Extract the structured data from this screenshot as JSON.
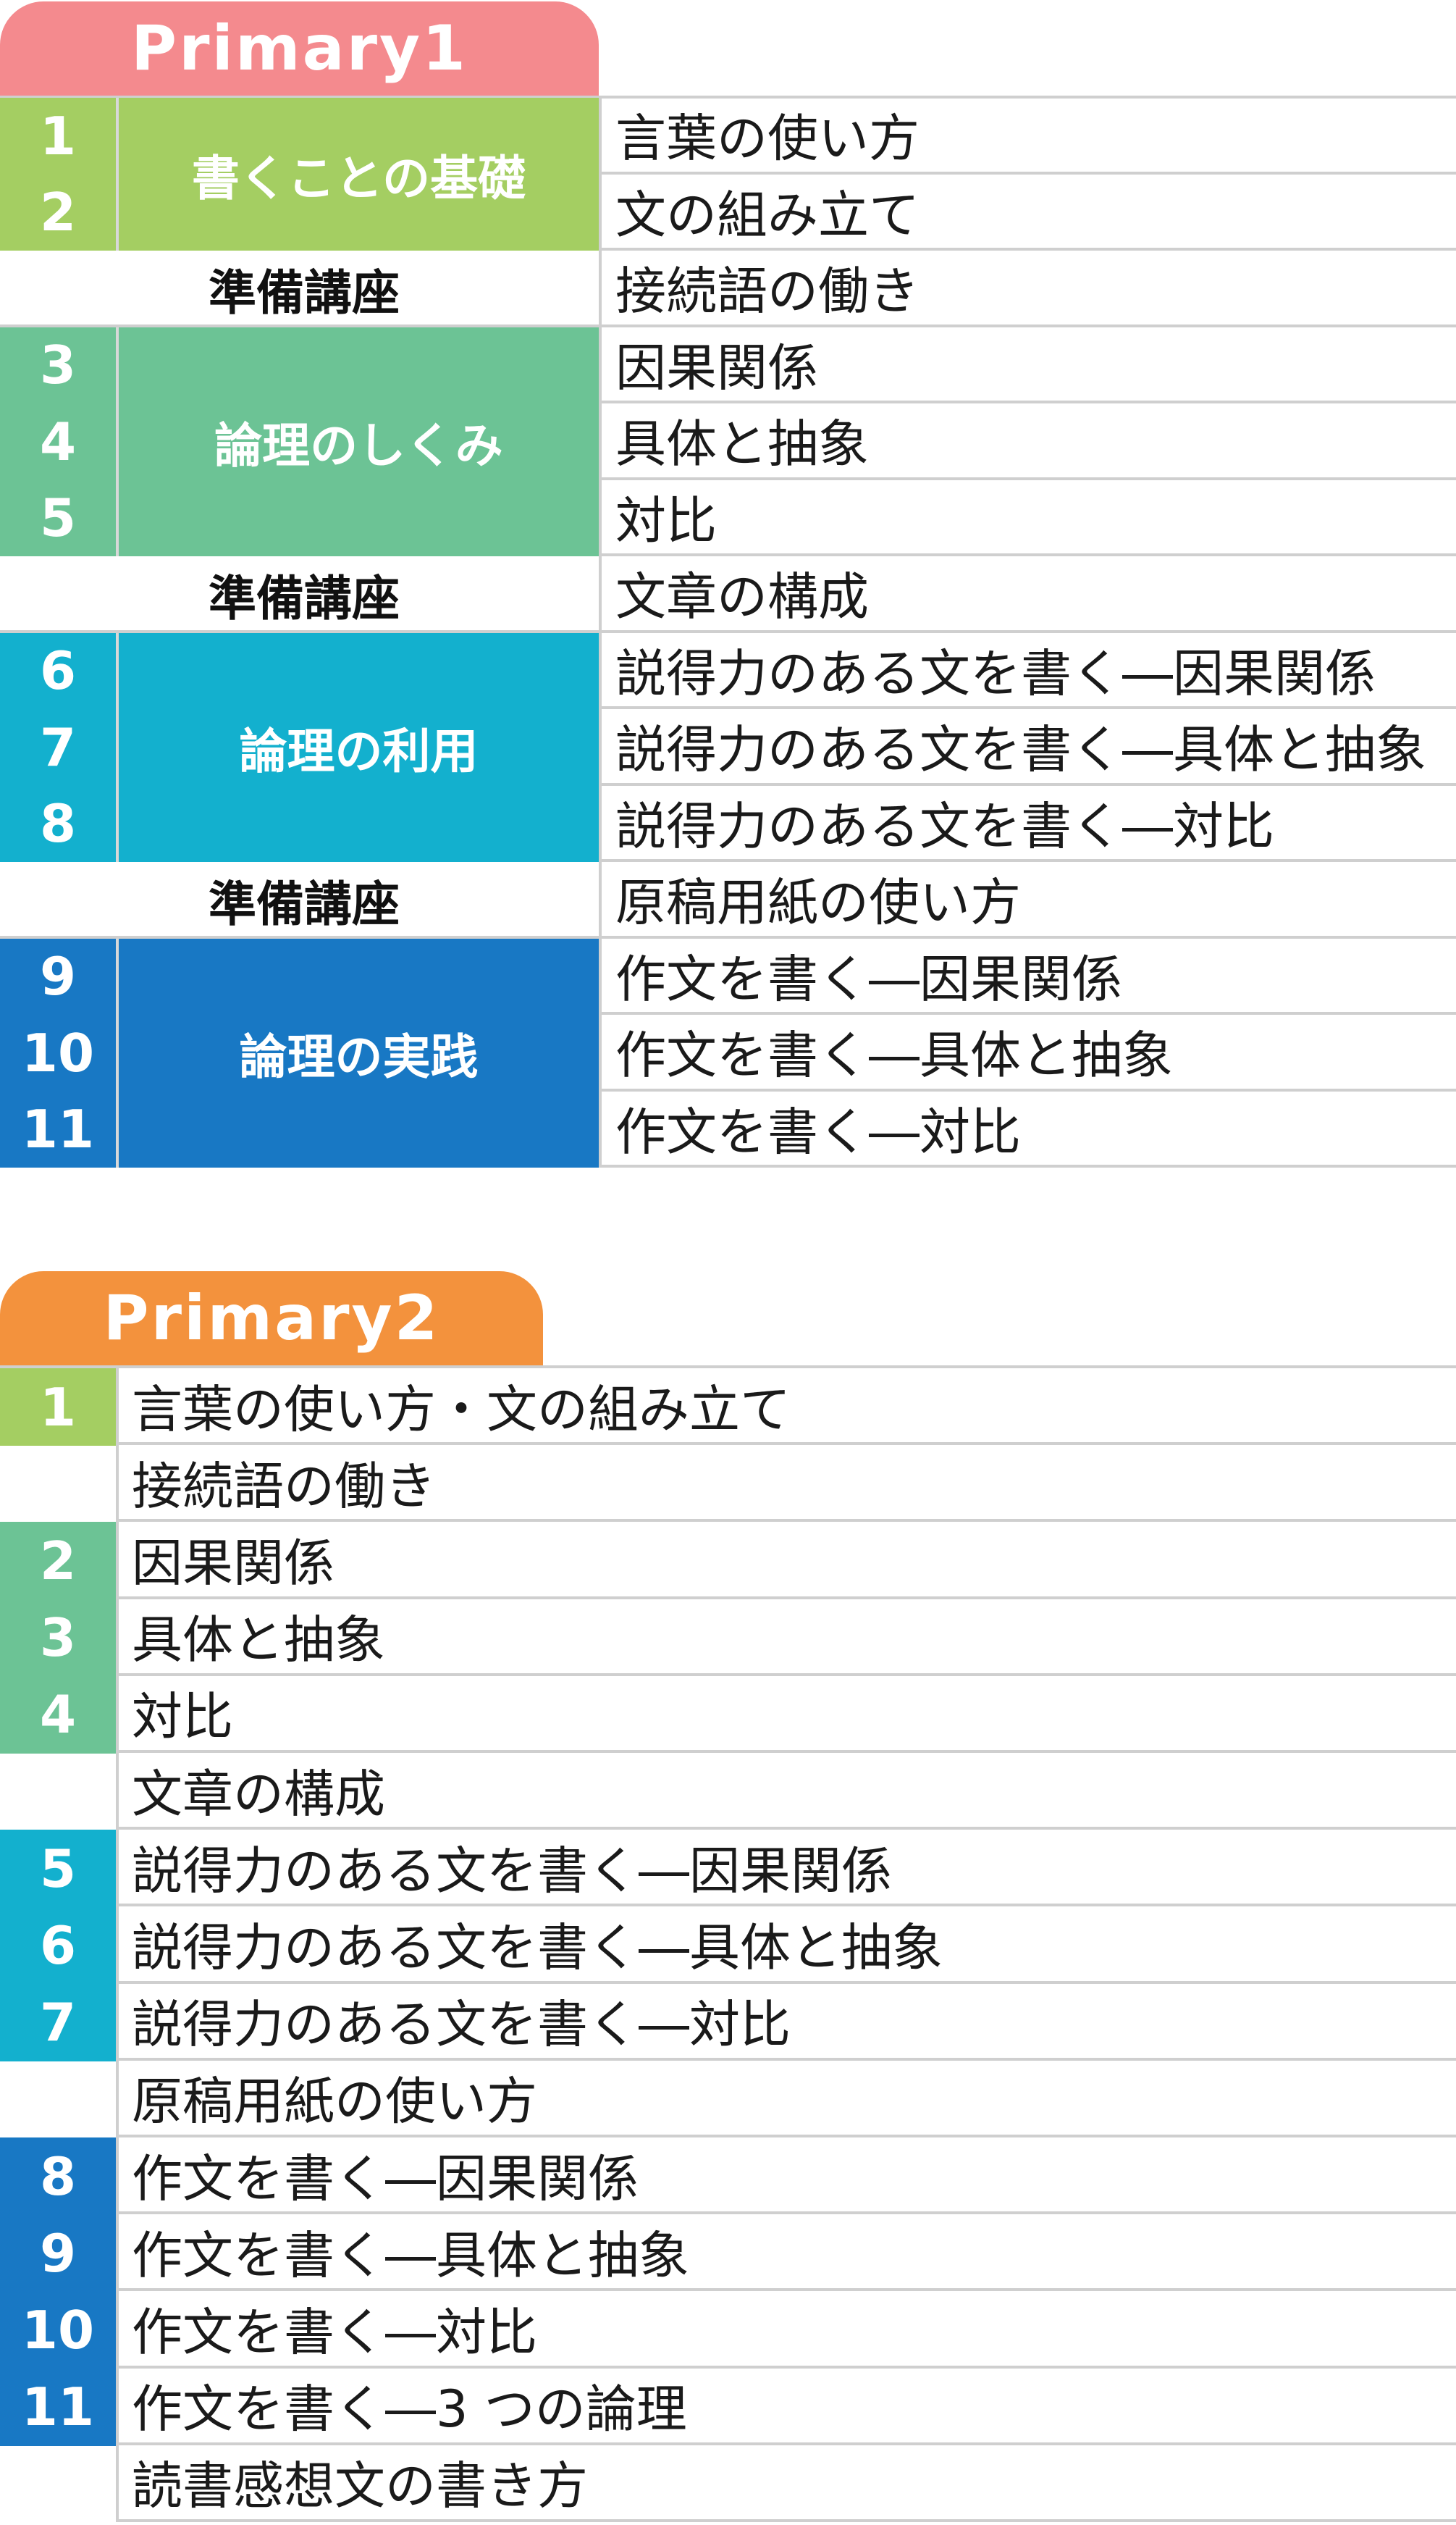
{
  "colors": {
    "primary1_tab": "#F48A8E",
    "primary2_tab": "#F3923D",
    "green_light": "#A4CE62",
    "green_teal": "#6CC395",
    "cyan": "#13B0CE",
    "blue": "#1878C4",
    "divider": "#CFCFCF"
  },
  "primary1": {
    "tab": "Primary1",
    "groups": [
      {
        "numbers": [
          "1",
          "2"
        ],
        "title": "書くことの基礎",
        "color": "#A4CE62",
        "lessons": [
          "言葉の使い方",
          "文の組み立て"
        ]
      },
      {
        "prep": "準備講座",
        "lesson": "接続語の働き"
      },
      {
        "numbers": [
          "3",
          "4",
          "5"
        ],
        "title": "論理のしくみ",
        "color": "#6CC395",
        "lessons": [
          "因果関係",
          "具体と抽象",
          "対比"
        ]
      },
      {
        "prep": "準備講座",
        "lesson": "文章の構成"
      },
      {
        "numbers": [
          "6",
          "7",
          "8"
        ],
        "title": "論理の利用",
        "color": "#13B0CE",
        "lessons": [
          "説得力のある文を書く―因果関係",
          "説得力のある文を書く―具体と抽象",
          "説得力のある文を書く―対比"
        ]
      },
      {
        "prep": "準備講座",
        "lesson": "原稿用紙の使い方"
      },
      {
        "numbers": [
          "9",
          "10",
          "11"
        ],
        "title": "論理の実践",
        "color": "#1878C4",
        "lessons": [
          "作文を書く―因果関係",
          "作文を書く―具体と抽象",
          "作文を書く―対比"
        ]
      }
    ]
  },
  "primary2": {
    "tab": "Primary2",
    "rows": [
      {
        "number": "1",
        "color": "#A4CE62",
        "lesson": "言葉の使い方・文の組み立て"
      },
      {
        "number": "",
        "color": "",
        "lesson": "接続語の働き"
      },
      {
        "number": "2",
        "color": "#6CC395",
        "lesson": "因果関係"
      },
      {
        "number": "3",
        "color": "#6CC395",
        "lesson": "具体と抽象"
      },
      {
        "number": "4",
        "color": "#6CC395",
        "lesson": "対比"
      },
      {
        "number": "",
        "color": "",
        "lesson": "文章の構成"
      },
      {
        "number": "5",
        "color": "#13B0CE",
        "lesson": "説得力のある文を書く―因果関係"
      },
      {
        "number": "6",
        "color": "#13B0CE",
        "lesson": "説得力のある文を書く―具体と抽象"
      },
      {
        "number": "7",
        "color": "#13B0CE",
        "lesson": "説得力のある文を書く―対比"
      },
      {
        "number": "",
        "color": "",
        "lesson": "原稿用紙の使い方"
      },
      {
        "number": "8",
        "color": "#1878C4",
        "lesson": "作文を書く―因果関係"
      },
      {
        "number": "9",
        "color": "#1878C4",
        "lesson": "作文を書く―具体と抽象"
      },
      {
        "number": "10",
        "color": "#1878C4",
        "lesson": "作文を書く―対比"
      },
      {
        "number": "11",
        "color": "#1878C4",
        "lesson": "作文を書く―3 つの論理"
      },
      {
        "number": "",
        "color": "",
        "lesson": "読書感想文の書き方"
      }
    ]
  }
}
